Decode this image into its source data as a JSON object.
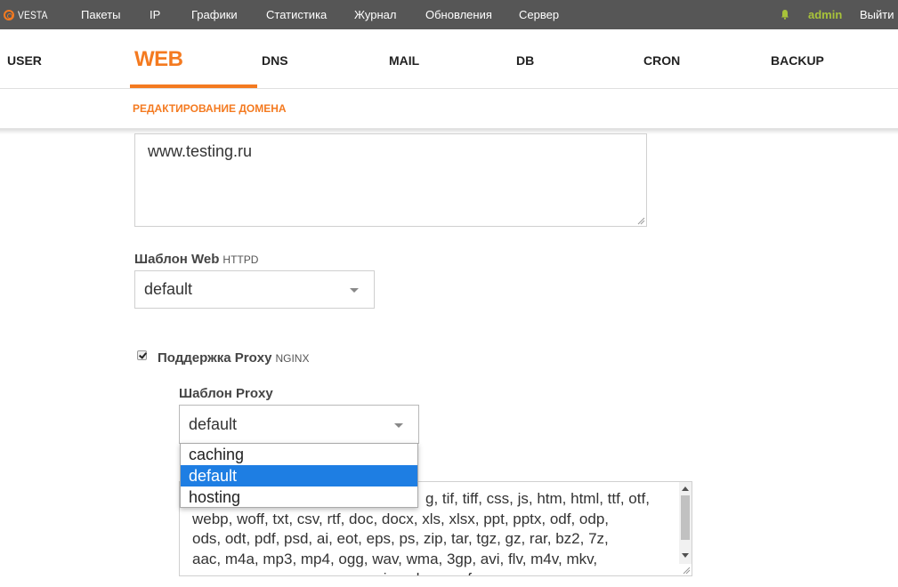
{
  "app": {
    "logo_text": "VESTA"
  },
  "topnav": {
    "items": [
      "Пакеты",
      "IP",
      "Графики",
      "Статистика",
      "Журнал",
      "Обновления",
      "Сервер"
    ],
    "user": "admin",
    "logout": "Выйти"
  },
  "tabs": {
    "items": [
      "USER",
      "WEB",
      "DNS",
      "MAIL",
      "DB",
      "CRON",
      "BACKUP"
    ],
    "active": "WEB"
  },
  "page": {
    "subtitle": "РЕДАКТИРОВАНИЕ ДОМЕНА"
  },
  "form": {
    "aliases_value": "www.testing.ru",
    "web_template": {
      "label": "Шаблон Web",
      "sub": "HTTPD",
      "value": "default"
    },
    "proxy": {
      "label": "Поддержка Proxy",
      "sub": "NGINX",
      "checked": true
    },
    "proxy_template": {
      "label": "Шаблон Proxy",
      "value": "default",
      "options": [
        "caching",
        "default",
        "hosting"
      ],
      "highlighted": "default"
    },
    "extensions": {
      "visible_tail": "g, tif, tiff, css, js, htm, html, ttf, otf,",
      "lines": [
        "webp, woff, txt, csv, rtf, doc, docx, xls, xlsx, ppt, pptx, odf, odp,",
        "ods, odt, pdf, psd, ai, eot, eps, ps, zip, tar, tgz, gz, rar, bz2, 7z,",
        "aac, m4a, mp3, mp4, ogg, wav, wma, 3gp, avi, flv, m4v, mkv,",
        "mov, mpeg, mpg, wmv, exe, iso, dmg, swf"
      ]
    }
  },
  "colors": {
    "accent": "#f47a20",
    "topbar": "#565656",
    "user": "#a8c33a",
    "selection": "#1e7ee3"
  }
}
